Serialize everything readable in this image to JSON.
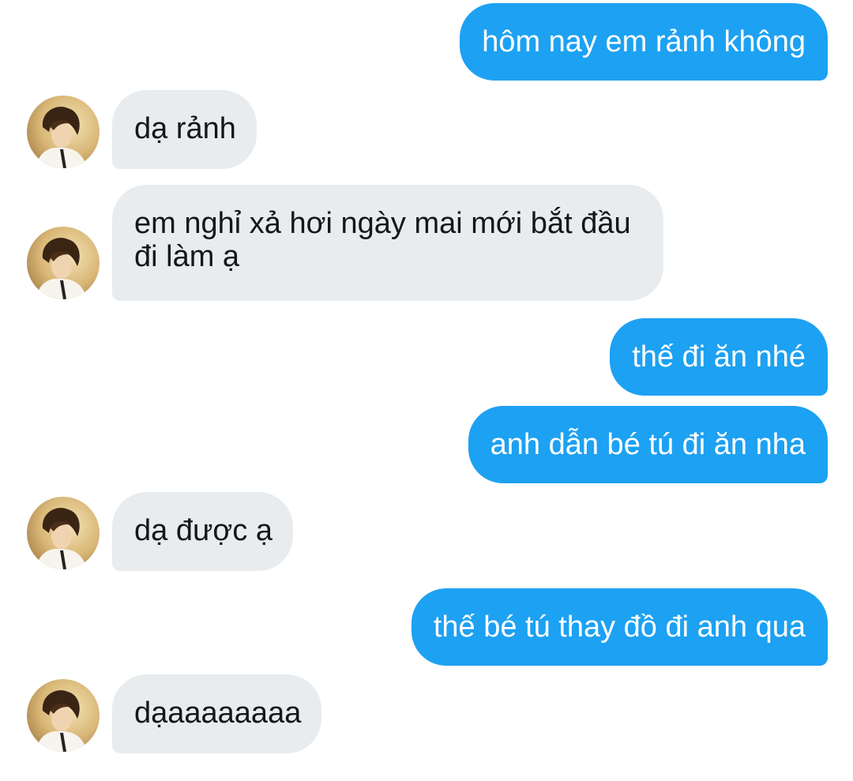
{
  "messages": [
    {
      "side": "outgoing",
      "text": "hôm nay em rảnh không"
    },
    {
      "side": "incoming",
      "text": "dạ rảnh"
    },
    {
      "side": "incoming",
      "text": "em nghỉ xả hơi ngày mai mới bắt đầu đi làm ạ"
    },
    {
      "side": "outgoing",
      "text": "thế đi ăn nhé"
    },
    {
      "side": "outgoing",
      "text": "anh dẫn bé tú đi ăn nha"
    },
    {
      "side": "incoming",
      "text": "dạ được ạ"
    },
    {
      "side": "outgoing",
      "text": "thế bé tú thay đồ đi anh qua"
    },
    {
      "side": "incoming",
      "text": "dạaaaaaaaa"
    }
  ],
  "colors": {
    "outgoing_bubble": "#1da1f2",
    "incoming_bubble": "#e8ecef",
    "incoming_text": "#14171a",
    "background": "#ffffff"
  },
  "icons": {
    "contact_avatar": "contact-avatar-photo"
  }
}
